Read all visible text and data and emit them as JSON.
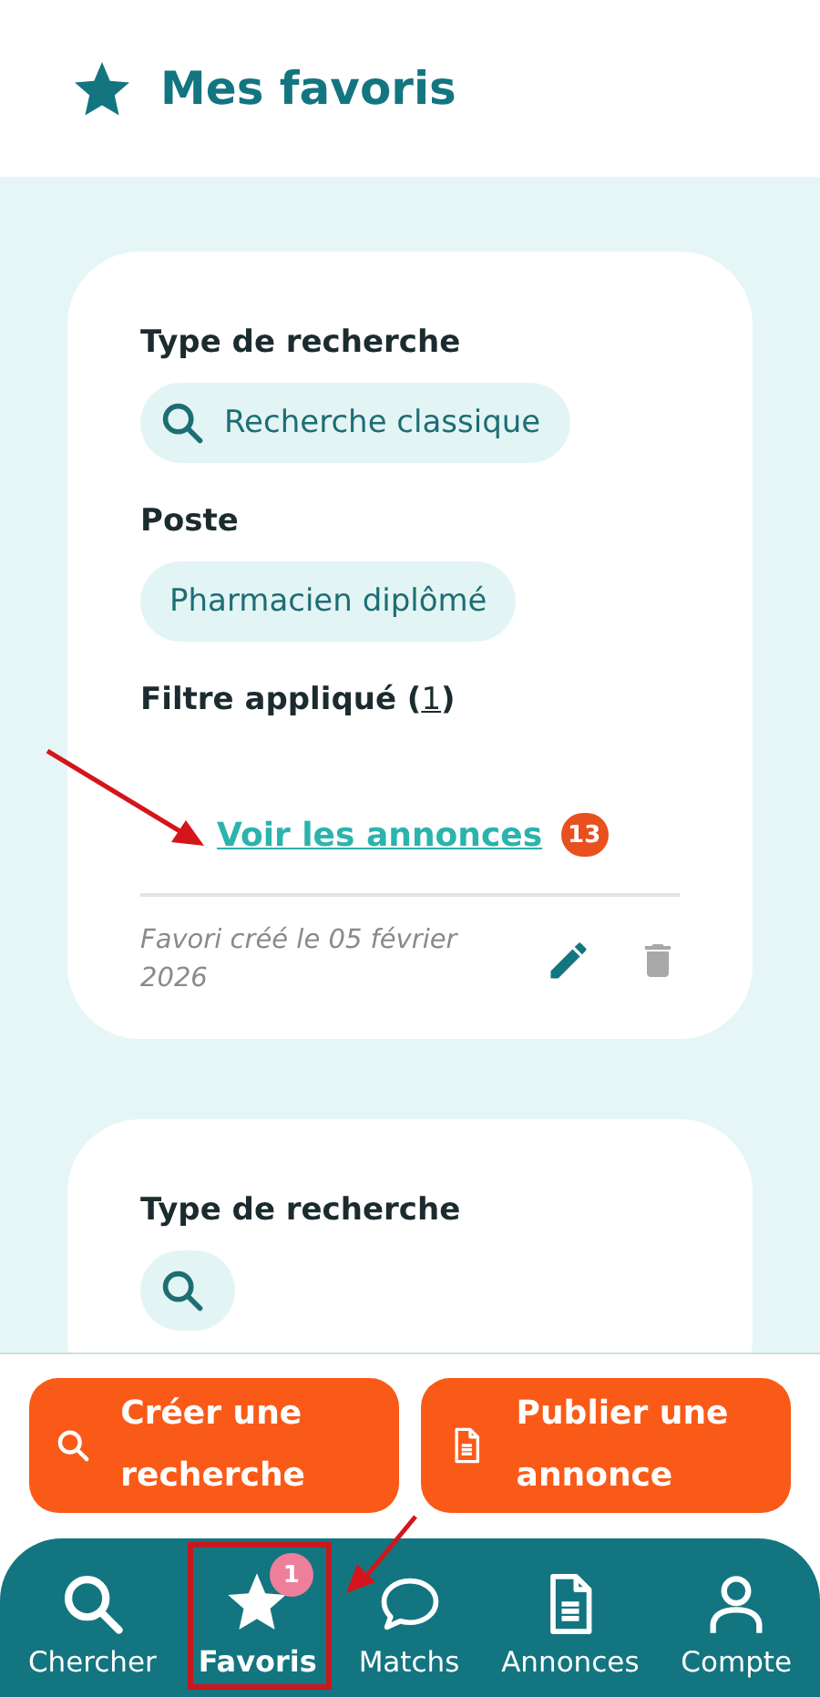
{
  "header": {
    "title": "Mes favoris"
  },
  "favorites": [
    {
      "search_type_label": "Type de recherche",
      "search_type": "Recherche classique",
      "position_label": "Poste",
      "position": "Pharmacien diplômé",
      "filter_prefix": "Filtre appliqué (",
      "filter_count": "1",
      "filter_suffix": ")",
      "link": "Voir les annonces",
      "count": "13",
      "created": "Favori créé le 05 février 2026"
    },
    {
      "search_type_label": "Type de recherche"
    }
  ],
  "actions": [
    {
      "kind": "search",
      "label": "Créer une recherche"
    },
    {
      "kind": "document",
      "label": "Publier une annonce"
    }
  ],
  "nav": [
    {
      "kind": "search",
      "label": "Chercher",
      "selected": false
    },
    {
      "kind": "star",
      "label": "Favoris",
      "selected": true,
      "badge": "1"
    },
    {
      "kind": "chat",
      "label": "Matchs",
      "selected": false
    },
    {
      "kind": "document",
      "label": "Annonces",
      "selected": false
    },
    {
      "kind": "user",
      "label": "Compte",
      "selected": false
    }
  ]
}
